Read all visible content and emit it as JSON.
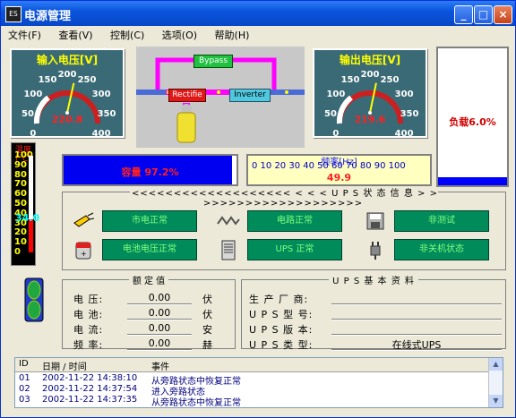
{
  "window": {
    "title": "电源管理",
    "icon_label": "ES"
  },
  "menu": [
    "文件(F)",
    "查看(V)",
    "控制(C)",
    "选项(O)",
    "帮助(H)"
  ],
  "input_gauge": {
    "title": "输入电压[V]",
    "value": "220.8",
    "ticks": [
      "0",
      "50",
      "100",
      "150",
      "200",
      "250",
      "300",
      "350",
      "400"
    ],
    "reading": 220.8,
    "max": 400
  },
  "output_gauge": {
    "title": "输出电压[V]",
    "value": "219.6",
    "ticks": [
      "0",
      "50",
      "100",
      "150",
      "200",
      "250",
      "300",
      "350",
      "400"
    ],
    "reading": 219.6,
    "max": 400
  },
  "diagram": {
    "bypass": "Bypass",
    "rectifier": "Rectifie",
    "inverter": "Inverter"
  },
  "load": {
    "text": "负载6.0%",
    "fraction": 0.06
  },
  "temperature": {
    "label": "温度[°C]",
    "value": "34.0",
    "ticks": [
      "100",
      "90",
      "80",
      "70",
      "60",
      "50",
      "40",
      "30",
      "20",
      "10",
      "0"
    ],
    "reading": 34.0
  },
  "capacity": {
    "text": "容量 97.2%",
    "fraction": 0.972
  },
  "frequency": {
    "label": "频率[Hz]",
    "scale": "0 10 20 30 40 50 60 70 80 90 100",
    "value": "49.9"
  },
  "ups_status": {
    "title": "<<<<<<<<<<<<<<<<<<< < < <  U P S 状 态 信 息  > > >>>>>>>>>>>>>>>>>>>",
    "items": [
      {
        "text": "市电正常",
        "icon": "mains-plug-icon"
      },
      {
        "text": "电路正常",
        "icon": "waveform-icon"
      },
      {
        "text": "非测试",
        "icon": "test-disk-icon"
      },
      {
        "text": "电池电压正常",
        "icon": "battery-status-icon"
      },
      {
        "text": "UPS 正常",
        "icon": "ups-unit-icon"
      },
      {
        "text": "非关机状态",
        "icon": "power-plug-icon"
      }
    ]
  },
  "rated": {
    "title": "额 定 值",
    "rows": [
      {
        "label": "电 压:",
        "value": "0.00",
        "unit": "伏"
      },
      {
        "label": "电 池:",
        "value": "0.00",
        "unit": "伏"
      },
      {
        "label": "电 流:",
        "value": "0.00",
        "unit": "安"
      },
      {
        "label": "频 率:",
        "value": "0.00",
        "unit": "赫"
      }
    ]
  },
  "ups_info": {
    "title": "U P S 基 本 资 料",
    "rows": [
      {
        "label": "生 产 厂 商:",
        "value": ""
      },
      {
        "label": "U P S 型 号:",
        "value": ""
      },
      {
        "label": "U P S 版 本:",
        "value": ""
      },
      {
        "label": "U P S 类 型:",
        "value": "在线式UPS"
      }
    ]
  },
  "log": {
    "headers": [
      "ID",
      "日期 / 时间",
      "事件"
    ],
    "rows": [
      {
        "id": "01",
        "time": "2002-11-22 14:38:10",
        "event": "从旁路状态中恢复正常"
      },
      {
        "id": "02",
        "time": "2002-11-22 14:37:54",
        "event": "进入旁路状态"
      },
      {
        "id": "03",
        "time": "2002-11-22 14:37:35",
        "event": "从旁路状态中恢复正常"
      }
    ]
  },
  "colors": {
    "gauge_bg": "#3a6a76",
    "status_green": "#008c5a",
    "capacity_blue": "#0000f0",
    "alarm_red": "#ff2020"
  }
}
